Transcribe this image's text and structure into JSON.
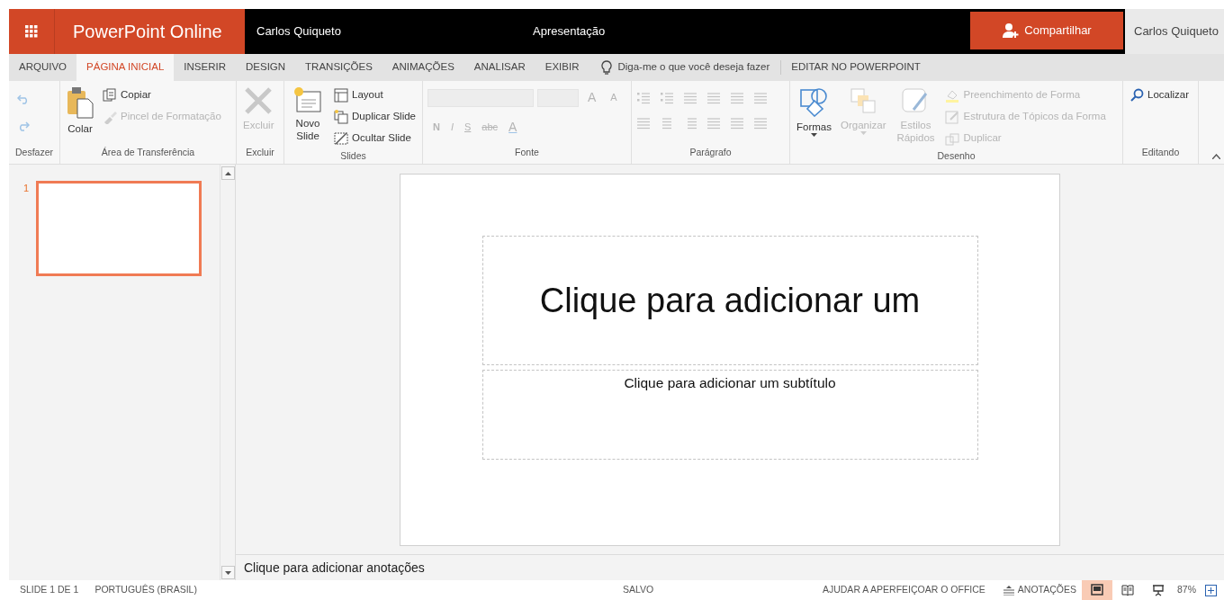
{
  "app_bar": {
    "app_name": "PowerPoint Online",
    "user": "Carlos Quiqueto",
    "document_title": "Apresentação",
    "share_button": "Compartilhar",
    "account": "Carlos Quiqueto"
  },
  "tabs": [
    {
      "label": "ARQUIVO",
      "selected": false
    },
    {
      "label": "PÁGINA INICIAL",
      "selected": true
    },
    {
      "label": "INSERIR",
      "selected": false
    },
    {
      "label": "DESIGN",
      "selected": false
    },
    {
      "label": "TRANSIÇÕES",
      "selected": false
    },
    {
      "label": "ANIMAÇÕES",
      "selected": false
    },
    {
      "label": "ANALISAR",
      "selected": false
    },
    {
      "label": "EXIBIR",
      "selected": false
    }
  ],
  "tell_me": "Diga-me o que você deseja fazer",
  "edit_in_app": "EDITAR NO POWERPOINT",
  "ribbon_groups": [
    {
      "label": "Desfazer",
      "kind": "buttons",
      "items": [
        {
          "kind": "icon",
          "disabled": true
        },
        {
          "kind": "icon",
          "disabled": true
        }
      ]
    },
    {
      "label": "Área de Transferência",
      "kind": "buttons",
      "items": [
        {
          "kind": "large",
          "label": "Colar",
          "disabled": false
        },
        {
          "kind": "small",
          "label": "Copiar",
          "disabled": false
        },
        {
          "kind": "small",
          "label": "Pincel de Formatação",
          "disabled": true
        }
      ]
    },
    {
      "label": "Excluir",
      "kind": "buttons",
      "items": [
        {
          "kind": "large",
          "label": "Excluir",
          "disabled": true
        }
      ]
    },
    {
      "label": "Slides",
      "kind": "buttons",
      "items": [
        {
          "kind": "large",
          "label": "Novo Slide",
          "disabled": false
        },
        {
          "kind": "small",
          "label": "Layout",
          "disabled": false
        },
        {
          "kind": "small",
          "label": "Duplicar Slide",
          "disabled": false
        },
        {
          "kind": "small",
          "label": "Ocultar Slide",
          "disabled": false
        }
      ]
    },
    {
      "label": "Fonte",
      "kind": "font",
      "size_buttons": [
        "A",
        "A"
      ],
      "format_buttons": [
        "N",
        "I",
        "S",
        "abc",
        "A"
      ]
    },
    {
      "label": "Parágrafo",
      "kind": "paragraph"
    },
    {
      "label": "Desenho",
      "kind": "buttons",
      "items": [
        {
          "kind": "large",
          "label": "Formas",
          "disabled": false
        },
        {
          "kind": "large",
          "label": "Organizar",
          "disabled": true
        },
        {
          "kind": "large",
          "label": "Estilos Rápidos",
          "disabled": true
        },
        {
          "kind": "small",
          "label": "Preenchimento de Forma",
          "disabled": true
        },
        {
          "kind": "small",
          "label": "Estrutura de Tópicos da Forma",
          "disabled": true
        },
        {
          "kind": "small",
          "label": "Duplicar",
          "disabled": true
        }
      ]
    },
    {
      "label": "Editando",
      "kind": "buttons",
      "items": [
        {
          "kind": "small",
          "label": "Localizar",
          "disabled": false
        }
      ]
    }
  ],
  "slides": [
    {
      "number": "1",
      "selected": true
    }
  ],
  "slide": {
    "title": "Clique para adicionar um",
    "subtitle": "Clique para adicionar um subtítulo"
  },
  "notes": "Clique para adicionar anotações",
  "status_bar": {
    "slide_count": "SLIDE 1 DE 1",
    "language": "PORTUGUÊS (BRASIL)",
    "save_state": "SALVO",
    "feedback": "AJUDAR A APERFEIÇOAR O OFFICE",
    "notes_button": "ANOTAÇÕES",
    "views": [
      {
        "selected": true
      },
      {
        "selected": false
      },
      {
        "selected": false
      }
    ],
    "zoom": "87%"
  }
}
